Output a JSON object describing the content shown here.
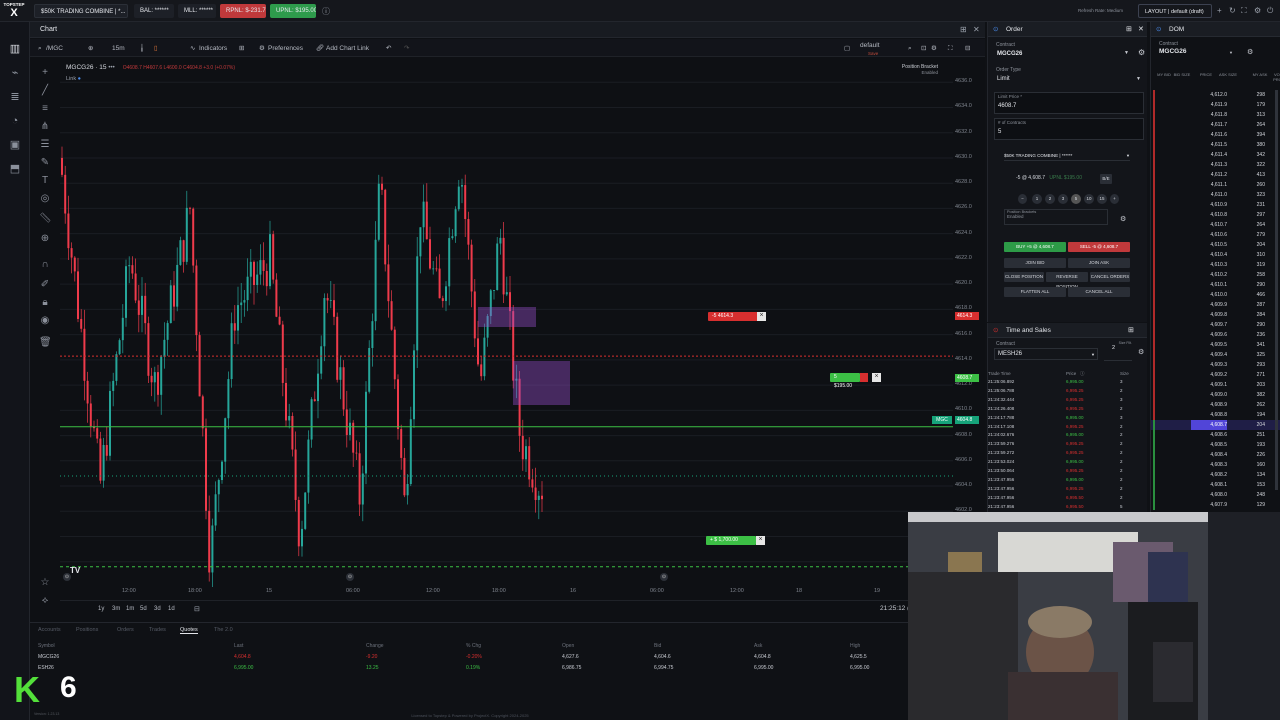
{
  "topbar": {
    "logo_line1": "TOPSTEP",
    "logo_line2": "X",
    "account": "$50K TRADING COMBINE | *...",
    "bal": "BAL: ******",
    "mll": "MLL: ******",
    "rpnl": "RPNL: $-231.79",
    "upnl": "UPNL: $195.00",
    "user": "Refresh Rate: Medium",
    "layout": "LAYOUT | default (draft)",
    "colors": {
      "rpnl_bg": "#c0393b",
      "upnl_bg": "#2e9b4c"
    }
  },
  "chart_panel": {
    "title": "Chart",
    "symbol_search": "/MGC",
    "interval": "15m",
    "indicators": "Indicators",
    "preferences": "Preferences",
    "add_chart_link": "Add Chart Link",
    "layout_name": "default",
    "layout_save": "Save",
    "legend_symbol": "MGCG26 · 15",
    "legend_ohlc": "O4608.7 H4607.6 L4600.0 C4604.8 +3.0 (+0.07%)",
    "link_label": "Link",
    "position_bracket": "Position Bracket",
    "position_bracket_status": "Enabled",
    "clock": "21:25:12 (UTC-5)",
    "ranges": [
      "1y",
      "3m",
      "1m",
      "5d",
      "3d",
      "1d"
    ]
  },
  "chart_data": {
    "type": "candlestick",
    "symbol": "MGCG26",
    "interval": "15m",
    "ylim": [
      4596,
      4638
    ],
    "y_ticks": [
      4636.0,
      4634.0,
      4632.0,
      4630.0,
      4628.0,
      4626.0,
      4624.0,
      4622.0,
      4620.0,
      4618.0,
      4616.0,
      4614.0,
      4612.0,
      4610.0,
      4608.0,
      4606.0,
      4604.0,
      4602.0,
      4600.0,
      4598.0
    ],
    "x_ticks": [
      "12:00",
      "18:00",
      "15",
      "06:00",
      "12:00",
      "18:00",
      "16",
      "06:00",
      "12:00",
      "18",
      "19"
    ],
    "price_markers": {
      "stop_order": "4614.3",
      "limit_order": "4608.7",
      "last_price": "4604.8",
      "last_label": "MGC"
    },
    "order_tags": {
      "stop": "-5 4614.3",
      "position": "5 $195.00",
      "take_profit": "+ $ 1,700.00"
    }
  },
  "order_panel": {
    "title": "Order",
    "contract_label": "Contract",
    "contract": "MGCG26",
    "order_type_label": "Order Type",
    "order_type": "Limit",
    "limit_price_label": "Limit Price *",
    "limit_price": "4608.7",
    "contracts_label": "# of Contracts",
    "contracts": "5",
    "account": "$50K TRADING COMBINE | ******",
    "position_line": "-5 @ 4,608.7",
    "upnl_line": "UPNL $195.00",
    "be_label": "B/E",
    "qty_buttons": [
      "1",
      "2",
      "3",
      "5",
      "10",
      "15"
    ],
    "bracket_label": "Position Brackets",
    "bracket_value": "Enabled",
    "buy_button": "BUY +5 @ 4,608.7",
    "sell_button": "SELL -5 @ 4,608.7",
    "join_bid": "JOIN BID",
    "join_ask": "JOIN ASK",
    "close_position": "CLOSE POSITION",
    "reverse_position": "REVERSE POSITION",
    "cancel_orders": "CANCEL ORDERS",
    "flatten_all": "FLATTEN ALL",
    "cancel_all": "CANCEL ALL"
  },
  "time_sales": {
    "title": "Time and Sales",
    "contract_label": "Contract",
    "contract": "MESH26",
    "size_filter_label": "Size Filt.",
    "size_filter": "2",
    "headers": [
      "Trade Time",
      "Price",
      "Size"
    ],
    "rows": [
      [
        "21:25:06.892",
        "6,995.00",
        "3"
      ],
      [
        "21:25:06.788",
        "6,995.25",
        "2"
      ],
      [
        "21:24:32.444",
        "6,995.25",
        "3"
      ],
      [
        "21:24:26.408",
        "6,995.25",
        "2"
      ],
      [
        "21:24:17.788",
        "6,995.00",
        "3"
      ],
      [
        "21:24:17.108",
        "6,995.25",
        "2"
      ],
      [
        "21:24:02.676",
        "6,995.00",
        "2"
      ],
      [
        "21:23:59.276",
        "6,995.25",
        "2"
      ],
      [
        "21:23:59.272",
        "6,995.25",
        "2"
      ],
      [
        "21:23:53.024",
        "6,995.00",
        "2"
      ],
      [
        "21:23:50.064",
        "6,995.25",
        "2"
      ],
      [
        "21:23:47.956",
        "6,995.00",
        "2"
      ],
      [
        "21:23:47.956",
        "6,995.25",
        "2"
      ],
      [
        "21:23:47.956",
        "6,995.50",
        "2"
      ],
      [
        "21:23:47.956",
        "6,995.50",
        "5"
      ],
      [
        "21:23:47.956",
        "6,995.50",
        "2"
      ]
    ],
    "row_colors": [
      "g",
      "r",
      "r",
      "r",
      "g",
      "r",
      "g",
      "r",
      "r",
      "g",
      "r",
      "g",
      "r",
      "r",
      "r",
      "r"
    ]
  },
  "dom": {
    "title": "DOM",
    "contract_label": "Contract",
    "contract": "MGCG26",
    "headers": [
      "MY BID",
      "BID SIZE",
      "PRICE",
      "ASK SIZE",
      "MY ASK",
      "VOL PRO."
    ],
    "rows": [
      [
        "4,612.0",
        "298"
      ],
      [
        "4,611.9",
        "179"
      ],
      [
        "4,611.8",
        "313"
      ],
      [
        "4,611.7",
        "264"
      ],
      [
        "4,611.6",
        "394"
      ],
      [
        "4,611.5",
        "380"
      ],
      [
        "4,611.4",
        "342"
      ],
      [
        "4,611.3",
        "322"
      ],
      [
        "4,611.2",
        "413"
      ],
      [
        "4,611.1",
        "260"
      ],
      [
        "4,611.0",
        "323"
      ],
      [
        "4,610.9",
        "231"
      ],
      [
        "4,610.8",
        "297"
      ],
      [
        "4,610.7",
        "264"
      ],
      [
        "4,610.6",
        "279"
      ],
      [
        "4,610.5",
        "204"
      ],
      [
        "4,610.4",
        "310"
      ],
      [
        "4,610.3",
        "319"
      ],
      [
        "4,610.2",
        "258"
      ],
      [
        "4,610.1",
        "290"
      ],
      [
        "4,610.0",
        "466"
      ],
      [
        "4,609.9",
        "287"
      ],
      [
        "4,609.8",
        "284"
      ],
      [
        "4,609.7",
        "290"
      ],
      [
        "4,609.6",
        "236"
      ],
      [
        "4,609.5",
        "341"
      ],
      [
        "4,609.4",
        "325"
      ],
      [
        "4,609.3",
        "293"
      ],
      [
        "4,609.2",
        "271"
      ],
      [
        "4,609.1",
        "203"
      ],
      [
        "4,609.0",
        "382"
      ],
      [
        "4,608.9",
        "262"
      ],
      [
        "4,608.8",
        "194"
      ],
      [
        "4,608.7",
        "204"
      ],
      [
        "4,608.6",
        "251"
      ],
      [
        "4,608.5",
        "193"
      ],
      [
        "4,608.4",
        "226"
      ],
      [
        "4,608.3",
        "160"
      ],
      [
        "4,608.2",
        "134"
      ],
      [
        "4,608.1",
        "153"
      ],
      [
        "4,608.0",
        "248"
      ],
      [
        "4,607.9",
        "129"
      ]
    ],
    "highlight_price": "4,608.7"
  },
  "quotes": {
    "tabs": [
      "Accounts",
      "Positions",
      "Orders",
      "Trades",
      "Quotes",
      "The 2.0"
    ],
    "active_tab": "Quotes",
    "headers": [
      "Symbol",
      "Last",
      "Change",
      "% Chg",
      "Open",
      "Bid",
      "Ask",
      "High"
    ],
    "rows": [
      [
        "MGCG26",
        "4,604.8",
        "-9.20",
        "-0.20%",
        "4,627.6",
        "4,604.6",
        "4,604.8",
        "4,625.5"
      ],
      [
        "ESH26",
        "6,995.00",
        "13.25",
        "0.19%",
        "6,986.75",
        "6,994.75",
        "6,995.00",
        "6,995.00"
      ]
    ]
  },
  "footer": "Licensed to Topstep & Powered by ProjectX. Copyright 2024-2025",
  "badge": {
    "letter": "K",
    "number": "6"
  },
  "version": "Version: 1.23.13"
}
